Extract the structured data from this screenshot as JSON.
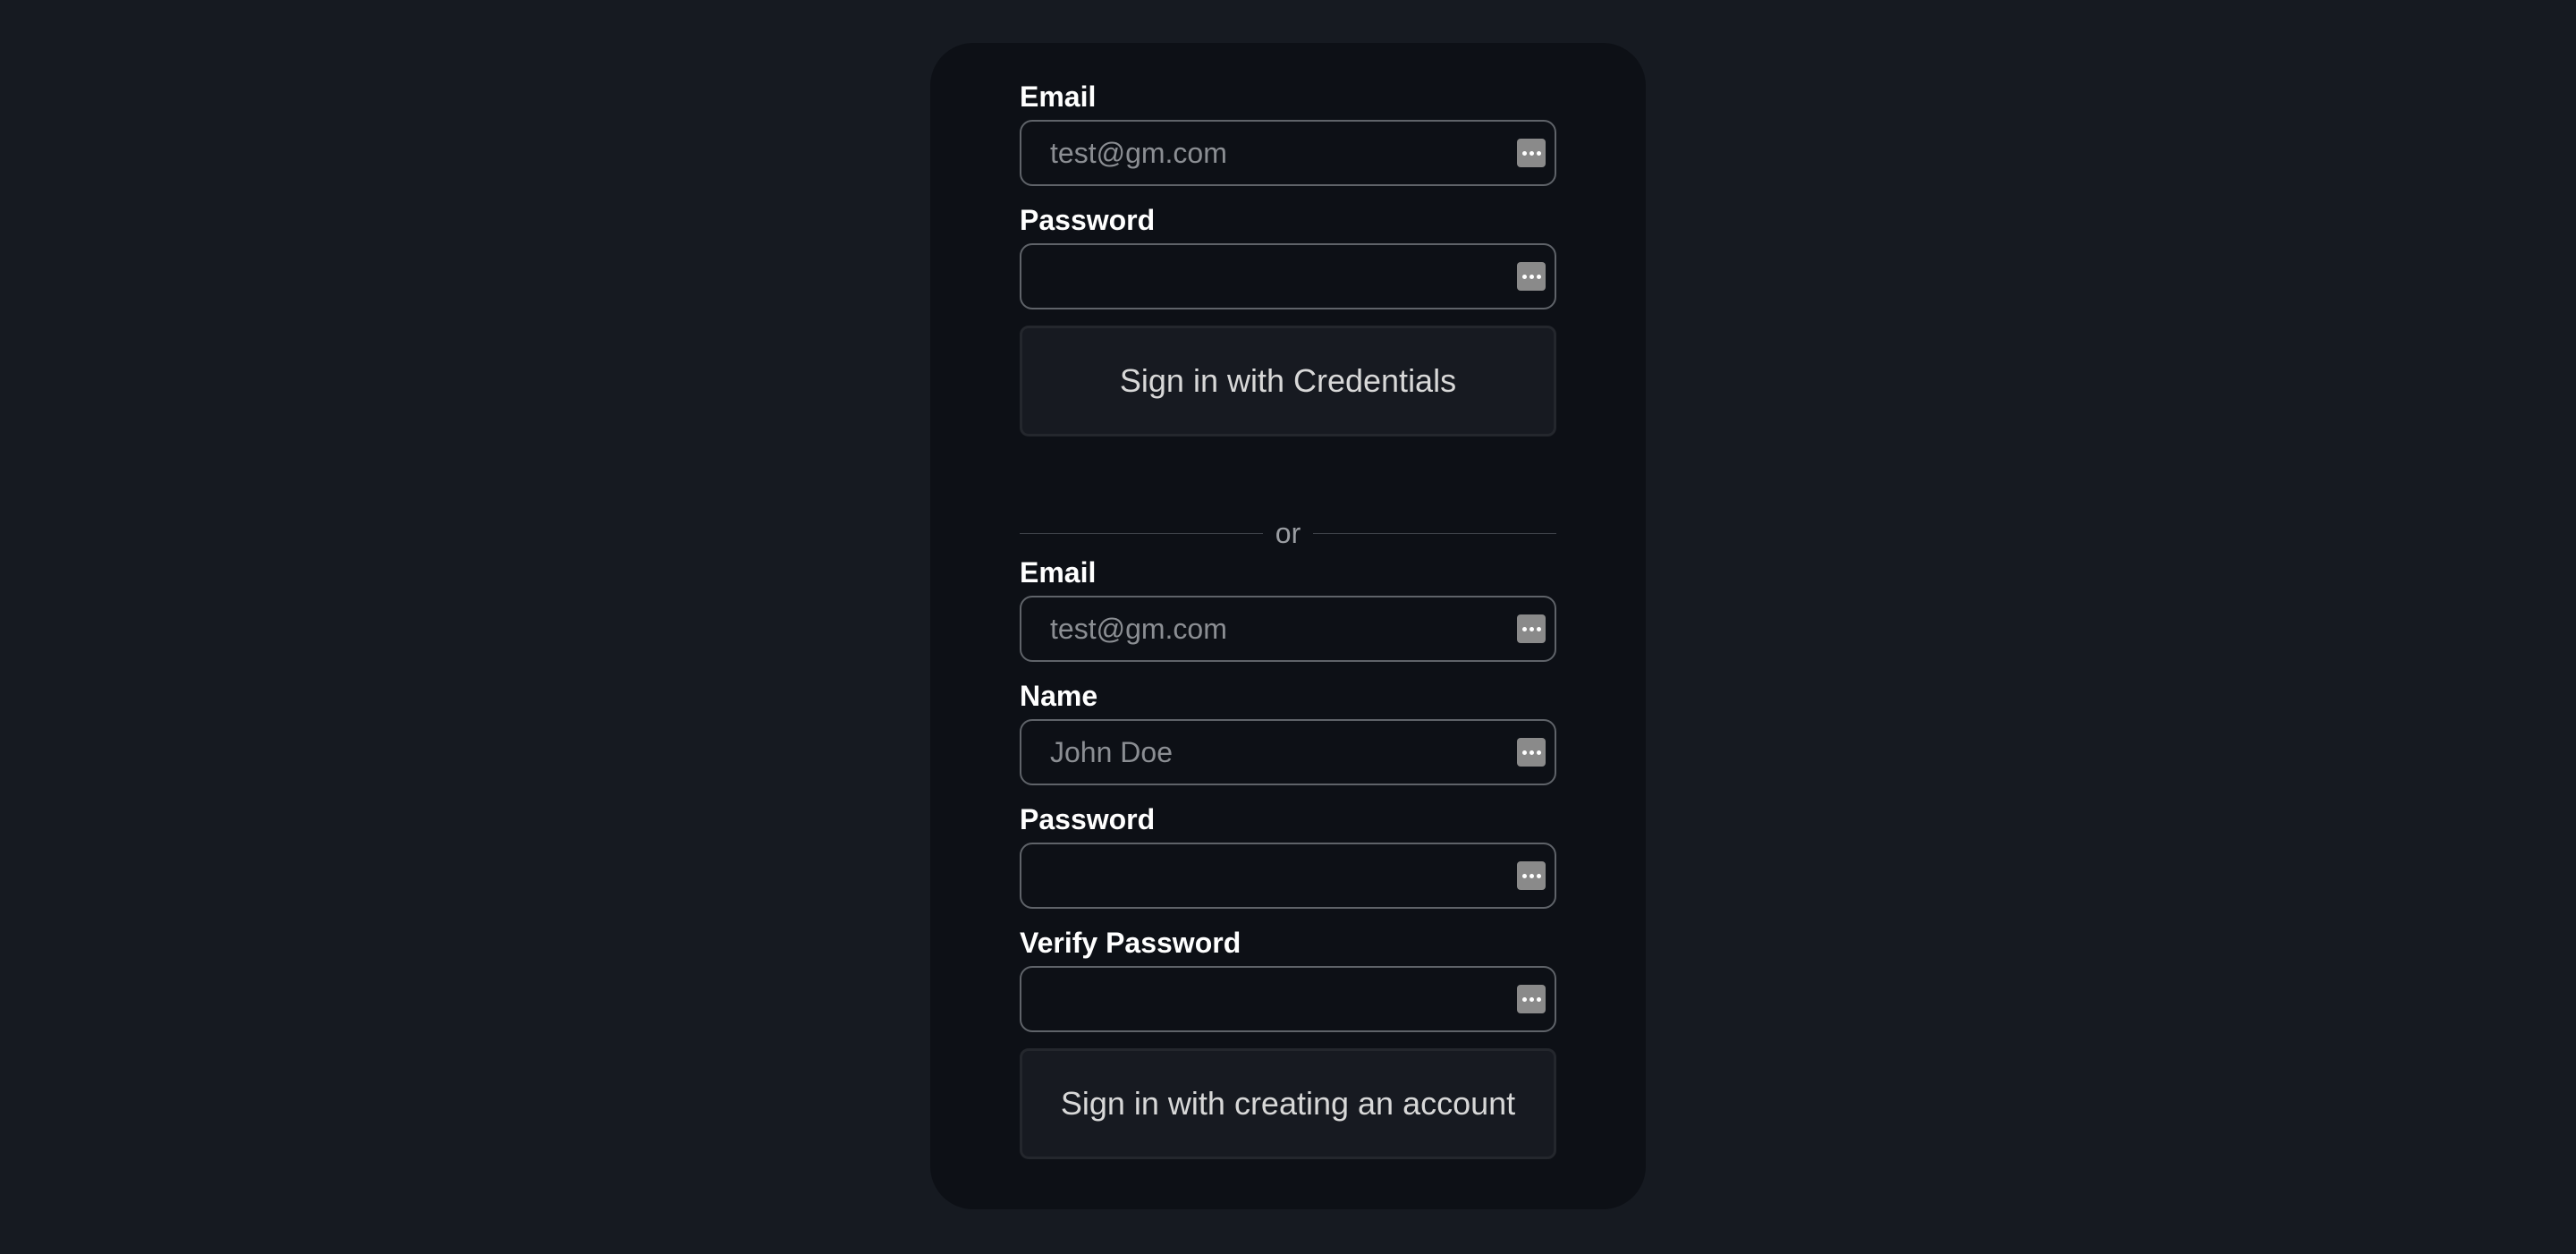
{
  "credentials_form": {
    "email_label": "Email",
    "email_placeholder": "test@gm.com",
    "email_value": "",
    "password_label": "Password",
    "password_value": "",
    "submit_label": "Sign in with Credentials"
  },
  "divider": {
    "text": "or"
  },
  "signup_form": {
    "email_label": "Email",
    "email_placeholder": "test@gm.com",
    "email_value": "",
    "name_label": "Name",
    "name_placeholder": "John Doe",
    "name_value": "",
    "password_label": "Password",
    "password_value": "",
    "verify_password_label": "Verify Password",
    "verify_password_value": "",
    "submit_label": "Sign in with creating an account"
  },
  "icons": {
    "field_trailing_icon": "password-manager-key-icon"
  },
  "colors": {
    "page_background": "#161a21",
    "card_background": "#0d1016",
    "label_text": "#ffffff",
    "placeholder_text": "#8b8e93",
    "input_border": "#5f6369",
    "button_background": "#171a21"
  }
}
